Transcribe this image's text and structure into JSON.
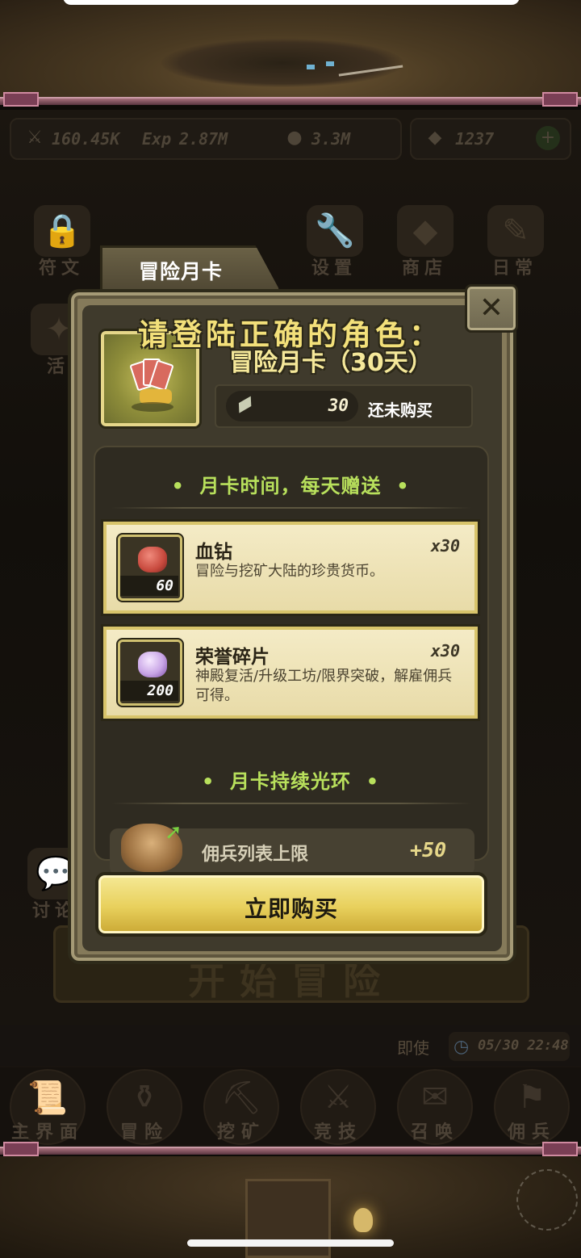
{
  "colors": {
    "accent_yellow": "#e8d05c",
    "section_green": "#b8e05c",
    "panel_bg": "#3f3a2c",
    "frame": "#857a5a"
  },
  "resources": [
    {
      "icon": "sword-icon",
      "value": "160.45K"
    },
    {
      "icon": "exp-icon",
      "label": "Exp",
      "value": "2.87M"
    },
    {
      "icon": "coin-icon",
      "value": "3.3M"
    },
    {
      "icon": "ruby-icon",
      "value": "1237"
    }
  ],
  "menu": {
    "rune": "符文",
    "settings": "设置",
    "shop": "商店",
    "daily": "日常",
    "activity": "活",
    "discuss": "讨论"
  },
  "background": {
    "start_button": "开始冒险",
    "status_text": "即使",
    "clock": "05/30 22:48"
  },
  "bottom_nav": [
    {
      "label": "主界面",
      "icon": "scroll-map-icon"
    },
    {
      "label": "冒险",
      "icon": "cauldron-icon"
    },
    {
      "label": "挖矿",
      "icon": "pickaxe-icon"
    },
    {
      "label": "竞技",
      "icon": "crossed-swords-icon"
    },
    {
      "label": "召唤",
      "icon": "summon-scroll-icon"
    },
    {
      "label": "佣兵",
      "icon": "mercenary-icon"
    }
  ],
  "popup": {
    "tab_title": "冒险月卡",
    "close_symbol": "✕",
    "overlay_message": "请登陆正确的角色：",
    "card_title": "冒险月卡（30天）",
    "price": {
      "icon": "ticket-icon",
      "value": "30",
      "status": "还未购买"
    },
    "daily_section_title": "月卡时间，每天赠送",
    "rewards": [
      {
        "name": "血钻",
        "multiplier": "x30",
        "description": "冒险与挖矿大陆的珍贵货币。",
        "item_qty": "60",
        "icon": "blood-diamond-icon",
        "color": "#c84a3e"
      },
      {
        "name": "荣誉碎片",
        "multiplier": "x30",
        "description": "神殿复活/升级工坊/限界突破，解雇佣兵可得。",
        "item_qty": "200",
        "icon": "honor-crystal-icon",
        "color": "#c9a6e6"
      }
    ],
    "aura_section_title": "月卡持续光环",
    "aura": {
      "text": "佣兵列表上限",
      "value": "+50",
      "icon": "mercenary-avatar-icon"
    },
    "buy_button": "立即购买"
  }
}
